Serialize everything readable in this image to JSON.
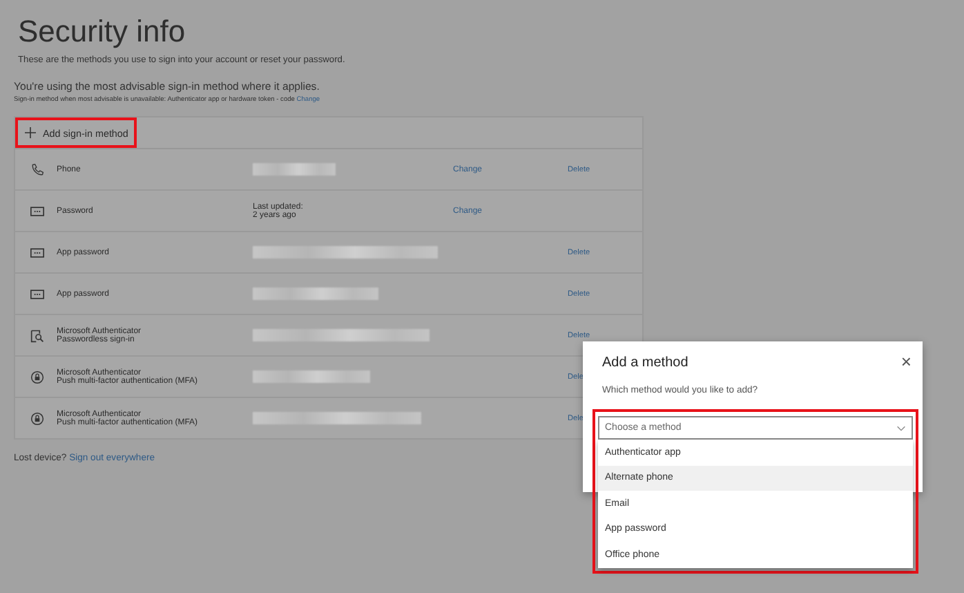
{
  "page": {
    "title": "Security info",
    "description": "These are the methods you use to sign into your account or reset your password.",
    "advisory": "You're using the most advisable sign-in method where it applies.",
    "fallback_note": "Sign-in method when most advisable is unavailable: Authenticator app or hardware token - code",
    "fallback_link": "Change"
  },
  "add_button": {
    "label": "Add sign-in method",
    "highlighted": true
  },
  "methods": [
    {
      "kind": "phone",
      "name": "Phone",
      "redacted": true,
      "change": "Change",
      "delete": "Delete"
    },
    {
      "kind": "password",
      "name": "Password",
      "value_lines": [
        "Last updated:",
        "2 years ago"
      ],
      "change": "Change"
    },
    {
      "kind": "password",
      "name": "App password",
      "redacted": true,
      "delete": "Delete"
    },
    {
      "kind": "password",
      "name": "App password",
      "redacted": true,
      "delete": "Delete"
    },
    {
      "kind": "passwordless",
      "name": "Microsoft Authenticator",
      "detail": "Passwordless sign-in",
      "redacted": true,
      "delete": "Delete"
    },
    {
      "kind": "push",
      "name": "Microsoft Authenticator",
      "detail": "Push multi-factor authentication (MFA)",
      "redacted": true,
      "delete": "Dele"
    },
    {
      "kind": "push",
      "name": "Microsoft Authenticator",
      "detail": "Push multi-factor authentication (MFA)",
      "redacted": true,
      "delete": "Dele"
    }
  ],
  "lost_device": {
    "label": "Lost device?",
    "link": "Sign out everywhere"
  },
  "dialog": {
    "title": "Add a method",
    "close": "×",
    "question": "Which method would you like to add?",
    "placeholder": "Choose a method",
    "highlighted": true,
    "options": [
      {
        "label": "Authenticator app",
        "selected": false
      },
      {
        "label": "Alternate phone",
        "selected": true
      },
      {
        "label": "Email",
        "selected": false
      },
      {
        "label": "App password",
        "selected": false
      },
      {
        "label": "Office phone",
        "selected": false
      }
    ]
  }
}
